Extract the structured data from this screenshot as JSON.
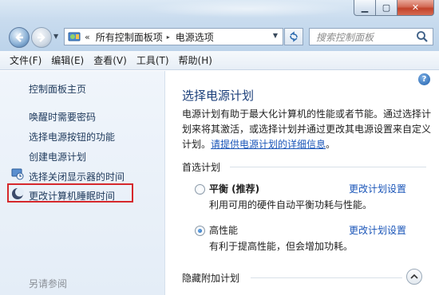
{
  "window": {
    "minimize_glyph": "▁",
    "maximize_glyph": "▢",
    "close_glyph": "✕"
  },
  "nav": {
    "back_icon": "back-arrow-icon",
    "forward_icon": "forward-arrow-icon"
  },
  "address": {
    "overflow": "«",
    "crumbs": [
      "所有控制面板项",
      "电源选项"
    ]
  },
  "search": {
    "placeholder": "搜索控制面板"
  },
  "menu": {
    "items": [
      "文件(F)",
      "编辑(E)",
      "查看(V)",
      "工具(T)",
      "帮助(H)"
    ]
  },
  "sidebar": {
    "home": "控制面板主页",
    "links": [
      "唤醒时需要密码",
      "选择电源按钮的功能",
      "创建电源计划",
      "选择关闭显示器的时间",
      "更改计算机睡眠时间"
    ],
    "see_also": "另请参阅"
  },
  "main": {
    "help": "?",
    "title": "选择电源计划",
    "description": "电源计划有助于最大化计算机的性能或者节能。通过选择计划来将其激活，或选择计划并通过更改其电源设置来自定义计划。",
    "description_link": "请提供电源计划的详细信息",
    "description_end": "。",
    "preferred_header": "首选计划",
    "plans": [
      {
        "name": "平衡 (推荐)",
        "desc": "利用可用的硬件自动平衡功耗与性能。",
        "link": "更改计划设置",
        "selected": false
      },
      {
        "name": "高性能",
        "desc": "有利于提高性能，但会增加功耗。",
        "link": "更改计划设置",
        "selected": true
      }
    ],
    "hidden_header": "隐藏附加计划"
  },
  "colors": {
    "highlight_box": "#d6282c",
    "link": "#1a55b8",
    "title": "#1b3f7a"
  }
}
